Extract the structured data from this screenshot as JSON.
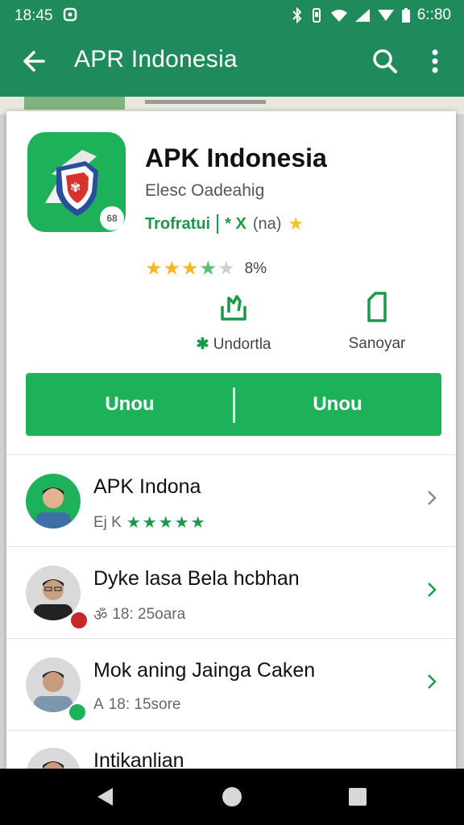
{
  "status": {
    "time": "18:45",
    "clock_right": "6::80"
  },
  "appbar": {
    "title": "APR Indonesia",
    "back_icon": "arrow-back-icon",
    "search_icon": "search-icon",
    "more_icon": "more-vert-icon"
  },
  "app": {
    "name": "APK Indonesia",
    "subtitle": "Elesc Oadeahig",
    "icon_badge": "68",
    "developer": "Trofratui",
    "meta_icons": "* X",
    "meta_extra": "(na)",
    "rating_percent": "8%",
    "rating_value": 3.5,
    "actions": [
      {
        "icon": "download-hand-icon",
        "prefix": "✱",
        "label": "Undortla"
      },
      {
        "icon": "bookmark-icon",
        "prefix": "",
        "label": "Sanoyar"
      }
    ],
    "buttons": [
      "Unou",
      "Unou"
    ]
  },
  "list": [
    {
      "title": "APK Indona",
      "sub_prefix": "Ej K",
      "sub_stars": "★★★★★",
      "sub_text": "",
      "avatar_bg": "#1db15a",
      "badge": ""
    },
    {
      "title": "Dyke lasa Bela hcbhan",
      "sub_prefix": "ॐ",
      "sub_stars": "",
      "sub_text": "18: 25oara",
      "avatar_bg": "#d9d9d9",
      "badge": "red"
    },
    {
      "title": "Mok aning Jainga Caken",
      "sub_prefix": "A",
      "sub_stars": "",
      "sub_text": "18: 15sore",
      "avatar_bg": "#d9d9d9",
      "badge": "green"
    },
    {
      "title": "Intikanlian",
      "sub_prefix": "",
      "sub_stars": "",
      "sub_text": "",
      "avatar_bg": "#d9d9d9",
      "badge": ""
    }
  ],
  "colors": {
    "primary": "#1f8a5b",
    "accent": "#1db15a",
    "star": "#f5b824"
  }
}
